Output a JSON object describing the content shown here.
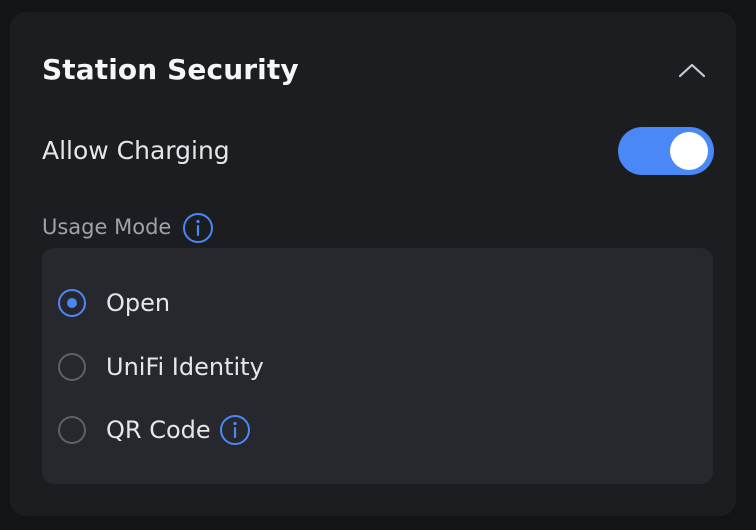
{
  "panel": {
    "title": "Station Security",
    "collapse_icon": "chevron-up-icon"
  },
  "allow_charging": {
    "label": "Allow Charging",
    "enabled": true
  },
  "usage_mode": {
    "label": "Usage Mode",
    "info_icon": "info-icon",
    "options": [
      {
        "label": "Open",
        "selected": true
      },
      {
        "label": "UniFi Identity",
        "selected": false
      },
      {
        "label": "QR Code",
        "selected": false,
        "has_info": true
      }
    ]
  },
  "colors": {
    "accent": "#4a88f7",
    "panel_background": "#1c1d21",
    "options_background": "#27282d",
    "text_primary": "#e4e6ea",
    "text_secondary": "#9ea2aa"
  }
}
